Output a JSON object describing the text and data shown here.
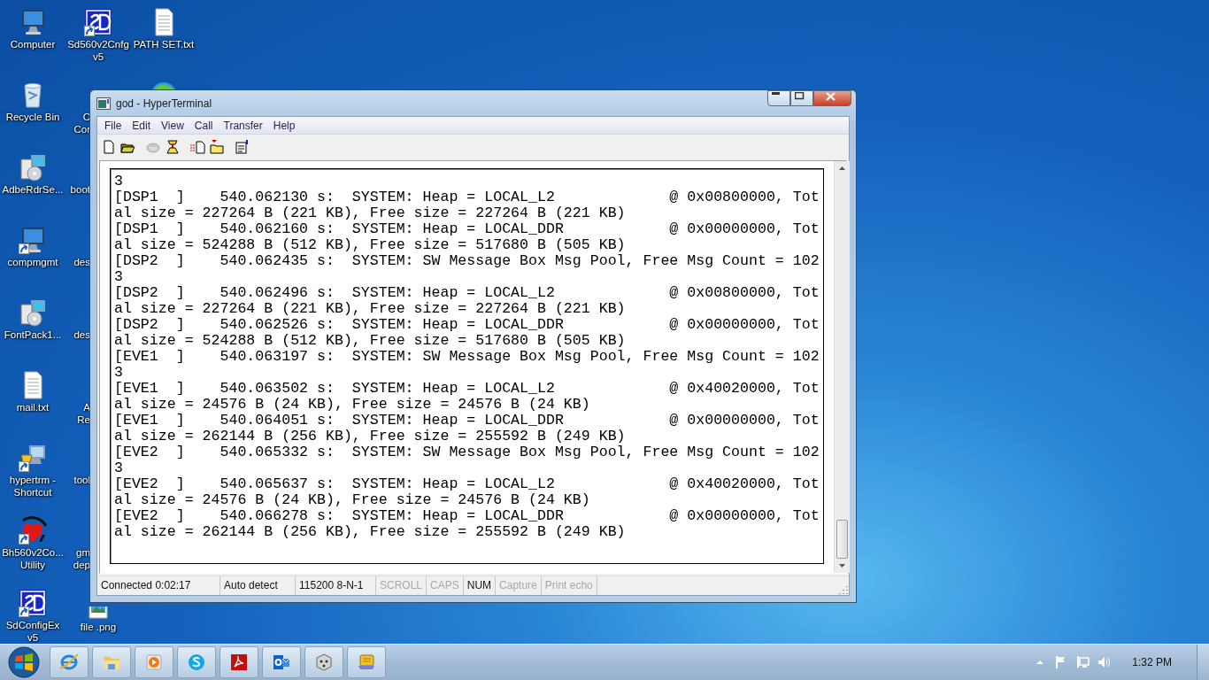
{
  "desktop_icons": [
    {
      "label": [
        "Computer"
      ],
      "kind": "computer",
      "shortcut": false,
      "cut": false
    },
    {
      "label": [
        "Recycle Bin"
      ],
      "kind": "recycle",
      "shortcut": false,
      "cut": false
    },
    {
      "label": [
        "AdbeRdrSe..."
      ],
      "kind": "installer",
      "shortcut": false,
      "cut": false
    },
    {
      "label": [
        "compmgmt"
      ],
      "kind": "computer",
      "shortcut": true,
      "cut": false
    },
    {
      "label": [
        "FontPack1..."
      ],
      "kind": "installer",
      "shortcut": false,
      "cut": false
    },
    {
      "label": [
        "mail.txt"
      ],
      "kind": "textfile",
      "shortcut": false,
      "cut": false
    },
    {
      "label": [
        "hypertrm -",
        "Shortcut"
      ],
      "kind": "hypertrm",
      "shortcut": true,
      "cut": false
    },
    {
      "label": [
        "Bh560v2Co...",
        "Utility"
      ],
      "kind": "heart",
      "shortcut": true,
      "cut": false
    },
    {
      "label": [
        "SdConfigEx",
        "v5"
      ],
      "kind": "sd",
      "shortcut": true,
      "cut": false
    },
    {
      "label": [
        "Sd560v2Cnfg",
        "v5"
      ],
      "kind": "sd",
      "shortcut": true,
      "cut": false
    },
    {
      "label": [
        "C",
        "Cor"
      ],
      "kind": "cube",
      "shortcut": false,
      "cut": true
    },
    {
      "label": [
        "boot"
      ],
      "kind": "generic",
      "shortcut": false,
      "cut": true
    },
    {
      "label": [
        "des"
      ],
      "kind": "generic",
      "shortcut": false,
      "cut": true
    },
    {
      "label": [
        "des"
      ],
      "kind": "generic",
      "shortcut": false,
      "cut": true
    },
    {
      "label": [
        "A",
        "Re"
      ],
      "kind": "pdf",
      "shortcut": false,
      "cut": true
    },
    {
      "label": [
        "tool"
      ],
      "kind": "generic",
      "shortcut": false,
      "cut": true
    },
    {
      "label": [
        "gm",
        "dep"
      ],
      "kind": "dark",
      "shortcut": false,
      "cut": true
    },
    {
      "label": [
        "file .png"
      ],
      "kind": "image",
      "shortcut": false,
      "cut": false
    },
    {
      "label": [
        "PATH SET.txt"
      ],
      "kind": "textfile",
      "shortcut": false,
      "cut": false
    },
    {
      "kind": "globe"
    }
  ],
  "window": {
    "title": "god - HyperTerminal",
    "menu": [
      "File",
      "Edit",
      "View",
      "Call",
      "Transfer",
      "Help"
    ],
    "toolbar": [
      {
        "kind": "new",
        "disabled": false
      },
      {
        "kind": "open",
        "disabled": false
      },
      {
        "kind": "phone",
        "disabled": true
      },
      {
        "kind": "dial",
        "disabled": false
      },
      {
        "kind": "send",
        "disabled": false
      },
      {
        "kind": "receive",
        "disabled": false
      },
      {
        "kind": "properties",
        "disabled": false
      }
    ],
    "terminal_lines": [
      "3",
      "[DSP1  ]    540.062130 s:  SYSTEM: Heap = LOCAL_L2             @ 0x00800000, Tot",
      "al size = 227264 B (221 KB), Free size = 227264 B (221 KB)",
      "[DSP1  ]    540.062160 s:  SYSTEM: Heap = LOCAL_DDR            @ 0x00000000, Tot",
      "al size = 524288 B (512 KB), Free size = 517680 B (505 KB)",
      "[DSP2  ]    540.062435 s:  SYSTEM: SW Message Box Msg Pool, Free Msg Count = 102",
      "3",
      "[DSP2  ]    540.062496 s:  SYSTEM: Heap = LOCAL_L2             @ 0x00800000, Tot",
      "al size = 227264 B (221 KB), Free size = 227264 B (221 KB)",
      "[DSP2  ]    540.062526 s:  SYSTEM: Heap = LOCAL_DDR            @ 0x00000000, Tot",
      "al size = 524288 B (512 KB), Free size = 517680 B (505 KB)",
      "[EVE1  ]    540.063197 s:  SYSTEM: SW Message Box Msg Pool, Free Msg Count = 102",
      "3",
      "[EVE1  ]    540.063502 s:  SYSTEM: Heap = LOCAL_L2             @ 0x40020000, Tot",
      "al size = 24576 B (24 KB), Free size = 24576 B (24 KB)",
      "[EVE1  ]    540.064051 s:  SYSTEM: Heap = LOCAL_DDR            @ 0x00000000, Tot",
      "al size = 262144 B (256 KB), Free size = 255592 B (249 KB)",
      "[EVE2  ]    540.065332 s:  SYSTEM: SW Message Box Msg Pool, Free Msg Count = 102",
      "3",
      "[EVE2  ]    540.065637 s:  SYSTEM: Heap = LOCAL_L2             @ 0x40020000, Tot",
      "al size = 24576 B (24 KB), Free size = 24576 B (24 KB)",
      "[EVE2  ]    540.066278 s:  SYSTEM: Heap = LOCAL_DDR            @ 0x00000000, Tot",
      "al size = 262144 B (256 KB), Free size = 255592 B (249 KB)"
    ],
    "status_bar": [
      {
        "text": "Connected 0:02:17",
        "disabled": false
      },
      {
        "text": "Auto detect",
        "disabled": false
      },
      {
        "text": "115200 8-N-1",
        "disabled": false
      },
      {
        "text": "SCROLL",
        "disabled": true
      },
      {
        "text": "CAPS",
        "disabled": true
      },
      {
        "text": "NUM",
        "disabled": false
      },
      {
        "text": "Capture",
        "disabled": true
      },
      {
        "text": "Print echo",
        "disabled": true
      }
    ]
  },
  "taskbar": {
    "apps": [
      {
        "kind": "browser"
      },
      {
        "kind": "folder"
      },
      {
        "kind": "media"
      },
      {
        "kind": "chat"
      },
      {
        "kind": "pdf"
      },
      {
        "kind": "mail"
      },
      {
        "kind": "cube"
      },
      {
        "kind": "terminal"
      }
    ],
    "clock": "1:32 PM"
  }
}
